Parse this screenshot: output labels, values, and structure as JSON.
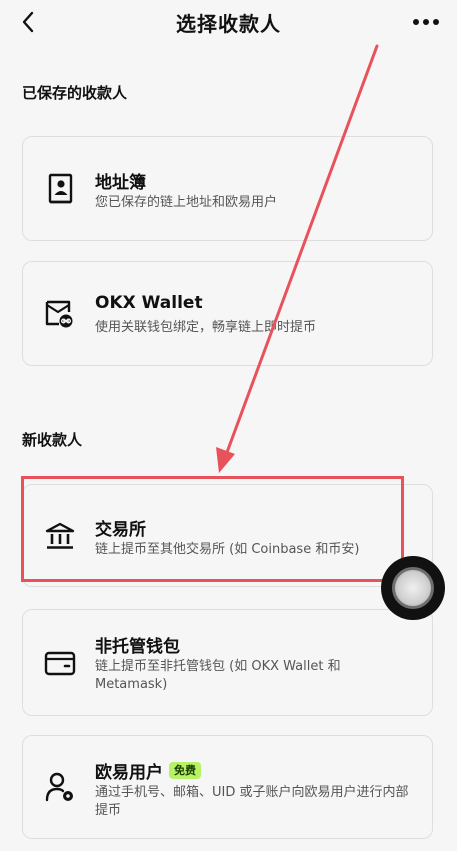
{
  "header": {
    "title": "选择收款人",
    "back_icon": "chevron-left-icon",
    "more_icon": "more-dots-icon"
  },
  "saved_section": {
    "title": "已保存的收款人",
    "items": [
      {
        "title": "地址簿",
        "desc": "您已保存的链上地址和欧易用户",
        "icon": "address-book-icon"
      },
      {
        "title": "OKX Wallet",
        "desc": "使用关联钱包绑定，畅享链上即时提币",
        "icon": "wallet-link-icon"
      }
    ]
  },
  "new_section": {
    "title": "新收款人",
    "items": [
      {
        "title": "交易所",
        "desc": "链上提币至其他交易所 (如 Coinbase 和币安)",
        "icon": "bank-icon"
      },
      {
        "title": "非托管钱包",
        "desc": "链上提币至非托管钱包 (如 OKX Wallet 和 Metamask)",
        "icon": "wallet-icon"
      },
      {
        "title": "欧易用户",
        "badge": "免费",
        "desc": "通过手机号、邮箱、UID 或子账户向欧易用户进行内部提币",
        "icon": "user-settings-icon"
      }
    ]
  },
  "colors": {
    "background": "#f6f6f6",
    "highlight": "#e8525b",
    "badge": "#b7f266"
  }
}
